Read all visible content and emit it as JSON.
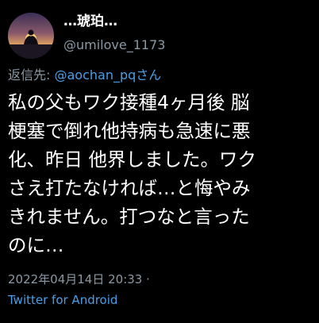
{
  "author": {
    "display_name": "…琥珀…",
    "handle": "@umilove_1173",
    "avatar": "sunset-silhouette-avatar"
  },
  "reply": {
    "prefix": "返信先: ",
    "mention": "@aochan_pqさん"
  },
  "tweet": {
    "lines": [
      "私の父もワク接種4ヶ月後 脳",
      "梗塞で倒れ他持病も急速に悪",
      "化、昨日 他界しました。ワク",
      "さえ打たなければ…と悔やみ",
      "きれません。打つなと言った",
      "のに…"
    ]
  },
  "meta": {
    "timestamp": "2022年04月14日 20:33 ·",
    "client": "Twitter for Android"
  },
  "colors": {
    "background": "#000000",
    "text": "#ffffff",
    "secondary": "#8b98a5",
    "link": "#4a9fe8"
  }
}
